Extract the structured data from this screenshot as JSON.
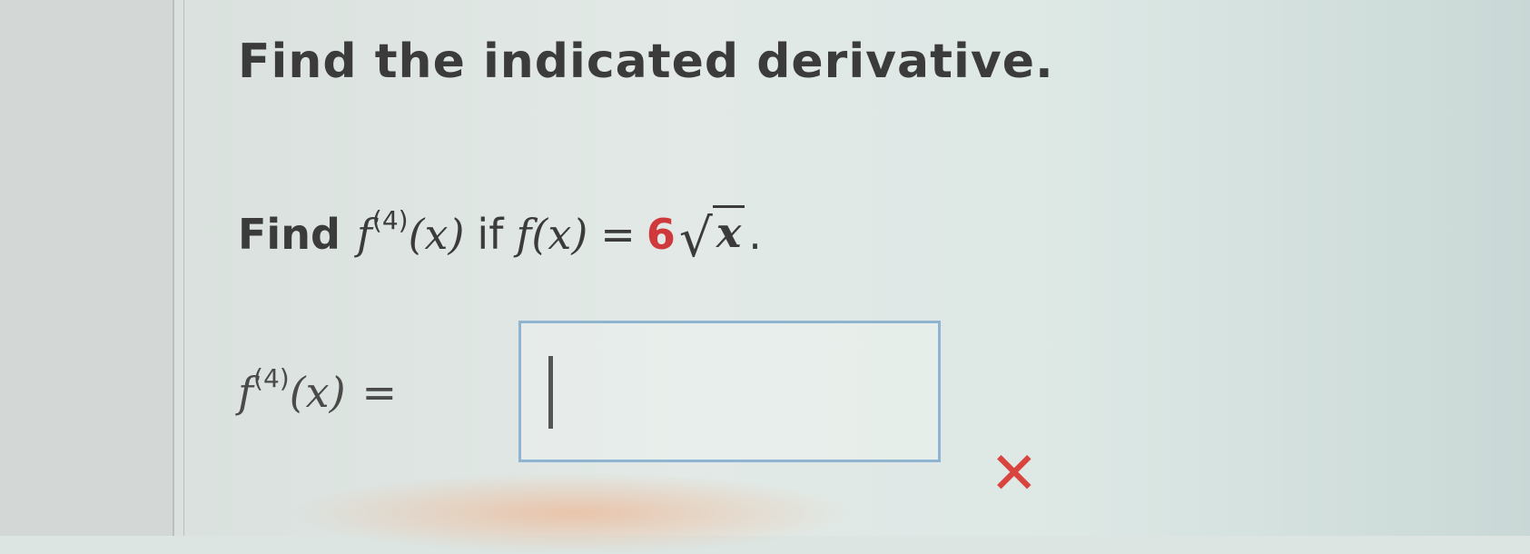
{
  "heading": "Find the indicated derivative.",
  "question": {
    "intro": "Find",
    "target_fn": "f",
    "order": "(4)",
    "target_arg": "(x)",
    "connector": "if",
    "given_fn": "f(x)",
    "equals": "=",
    "coefficient": "6",
    "sqrt_symbol": "√",
    "radicand": "x",
    "end": "."
  },
  "answer": {
    "fn": "f",
    "order": "(4)",
    "arg": "(x)",
    "equals": "=",
    "value": ""
  },
  "status": {
    "icon": "x-mark-icon",
    "glyph": "✕",
    "color": "#d9443f"
  }
}
